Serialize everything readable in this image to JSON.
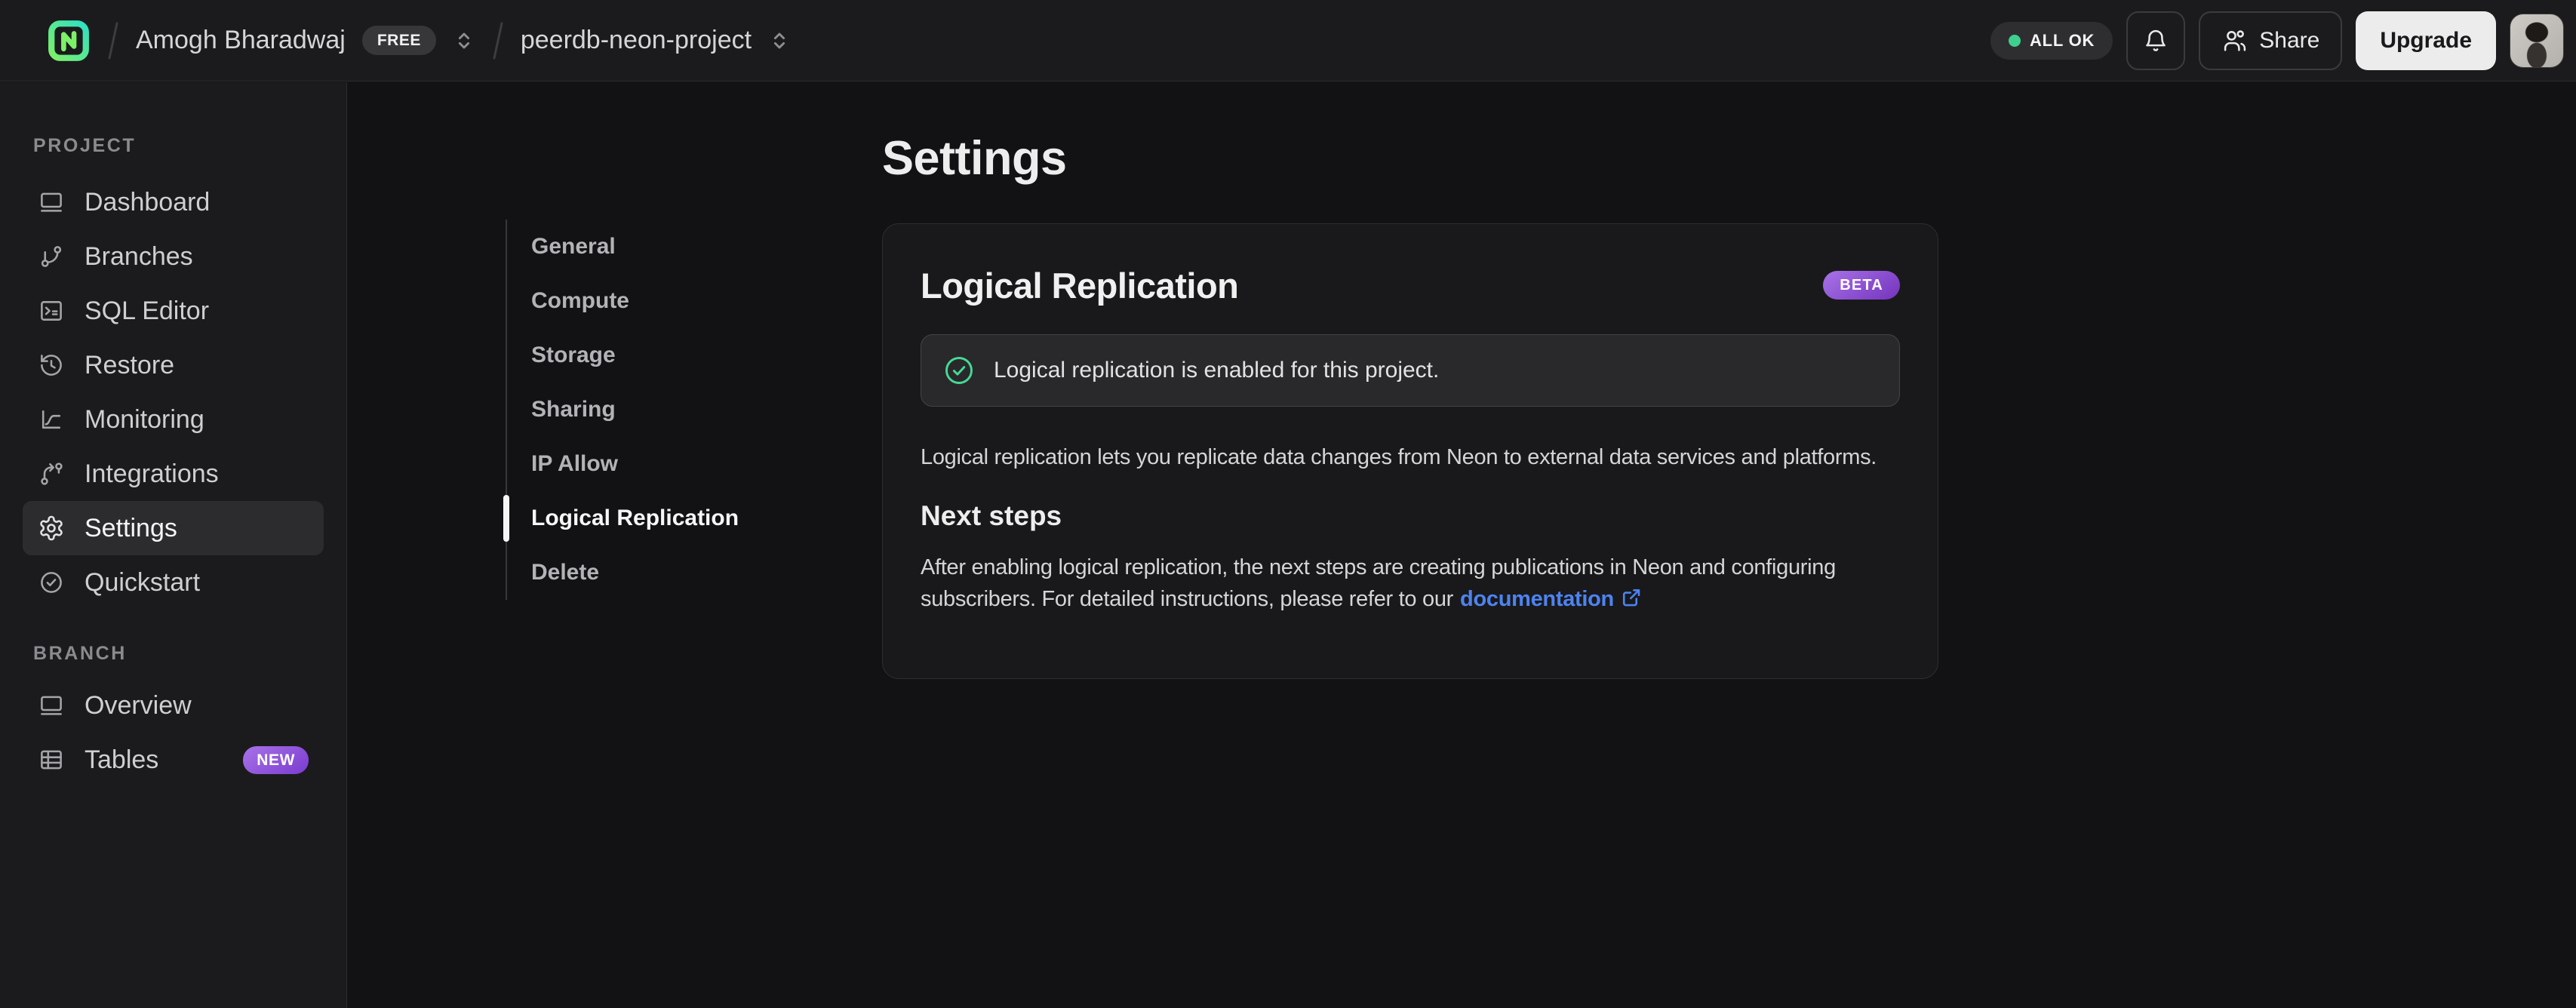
{
  "colors": {
    "accent_green": "#3ecf8e",
    "link_blue": "#4d83f0",
    "badge_purple": "#8b4fe0",
    "panel_bg": "#1b1b1d",
    "page_bg": "#121214"
  },
  "topbar": {
    "logo": "neon-logo",
    "breadcrumb": {
      "org_name": "Amogh Bharadwaj",
      "org_plan_badge": "FREE",
      "project_name": "peerdb-neon-project"
    },
    "status_pill": "ALL OK",
    "share_label": "Share",
    "upgrade_label": "Upgrade"
  },
  "sidebar": {
    "sections": [
      {
        "label": "PROJECT",
        "items": [
          {
            "label": "Dashboard",
            "icon": "dashboard-window-icon",
            "active": false
          },
          {
            "label": "Branches",
            "icon": "git-branch-icon",
            "active": false
          },
          {
            "label": "SQL Editor",
            "icon": "terminal-icon",
            "active": false
          },
          {
            "label": "Restore",
            "icon": "history-clock-icon",
            "active": false
          },
          {
            "label": "Monitoring",
            "icon": "chart-curve-icon",
            "active": false
          },
          {
            "label": "Integrations",
            "icon": "integrations-flow-icon",
            "active": false
          },
          {
            "label": "Settings",
            "icon": "gear-icon",
            "active": true
          },
          {
            "label": "Quickstart",
            "icon": "check-circle-icon",
            "active": false
          }
        ]
      },
      {
        "label": "BRANCH",
        "items": [
          {
            "label": "Overview",
            "icon": "overview-window-icon",
            "active": false
          },
          {
            "label": "Tables",
            "icon": "table-icon",
            "active": false,
            "badge": "NEW"
          }
        ]
      }
    ]
  },
  "settings_nav": {
    "items": [
      {
        "label": "General",
        "active": false
      },
      {
        "label": "Compute",
        "active": false
      },
      {
        "label": "Storage",
        "active": false
      },
      {
        "label": "Sharing",
        "active": false
      },
      {
        "label": "IP Allow",
        "active": false
      },
      {
        "label": "Logical Replication",
        "active": true
      },
      {
        "label": "Delete",
        "active": false
      }
    ]
  },
  "main": {
    "page_title": "Settings",
    "card": {
      "title": "Logical Replication",
      "beta_badge": "BETA",
      "status_banner": "Logical replication is enabled for this project.",
      "description": "Logical replication lets you replicate data changes from Neon to external data services and platforms.",
      "next_steps": {
        "title": "Next steps",
        "text_before_link": "After enabling logical replication, the next steps are creating publications in Neon and configuring subscribers. For detailed instructions, please refer to our",
        "link_label": "documentation"
      }
    }
  }
}
